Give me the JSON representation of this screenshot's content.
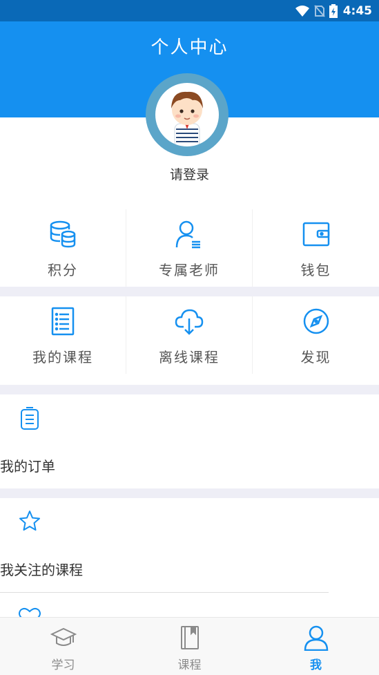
{
  "status_bar": {
    "time": "4:45"
  },
  "header": {
    "title": "个人中心"
  },
  "profile": {
    "login_prompt": "请登录"
  },
  "grid_row1": [
    {
      "label": "积分",
      "icon": "database-icon"
    },
    {
      "label": "专属老师",
      "icon": "teacher-icon"
    },
    {
      "label": "钱包",
      "icon": "wallet-icon"
    }
  ],
  "grid_row2": [
    {
      "label": "我的课程",
      "icon": "document-list-icon"
    },
    {
      "label": "离线课程",
      "icon": "cloud-download-icon"
    },
    {
      "label": "发现",
      "icon": "compass-icon"
    }
  ],
  "list": [
    {
      "label": "我的订单",
      "icon": "clipboard-icon"
    },
    {
      "label": "我关注的课程",
      "icon": "star-icon"
    },
    {
      "label": "",
      "icon": "heart-icon"
    }
  ],
  "tabbar": [
    {
      "label": "学习",
      "icon": "graduation-cap-icon",
      "active": false
    },
    {
      "label": "课程",
      "icon": "book-icon",
      "active": false
    },
    {
      "label": "我",
      "icon": "user-icon",
      "active": true
    }
  ],
  "colors": {
    "primary": "#1590f0",
    "status_bar": "#0a69b7",
    "separator": "#eeeef6"
  }
}
